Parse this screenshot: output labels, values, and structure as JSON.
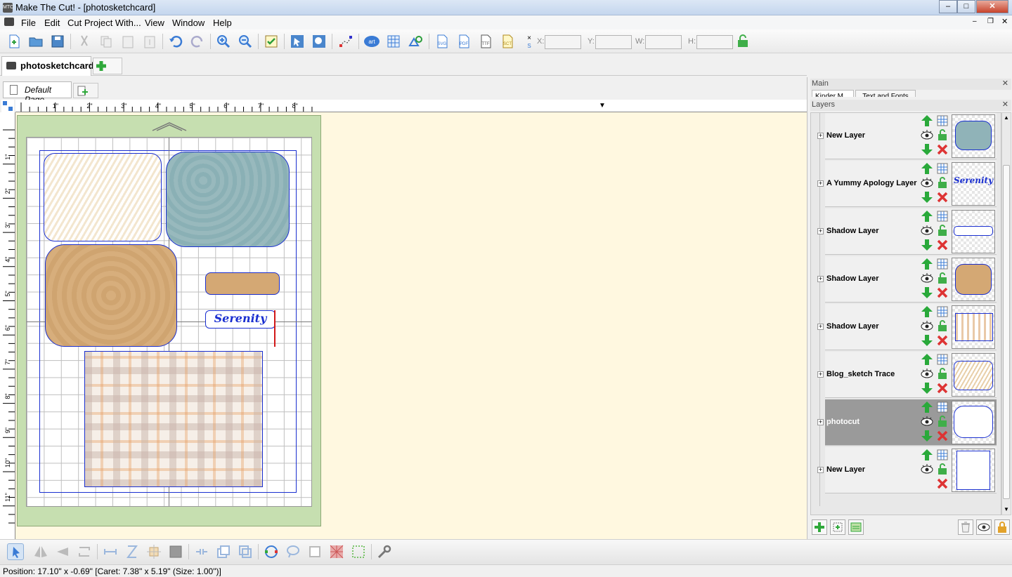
{
  "window": {
    "title": "Make The Cut! - [photosketchcard]"
  },
  "menu": [
    "File",
    "Edit",
    "Cut Project With...",
    "View",
    "Window",
    "Help"
  ],
  "coords": {
    "x_label": "X:",
    "y_label": "Y:",
    "w_label": "W:",
    "h_label": "H:"
  },
  "doc_tab": {
    "label": "photosketchcard"
  },
  "page_tab": {
    "label": "Default Page"
  },
  "ruler": {
    "h_ticks": [
      "1\"",
      "2\"",
      "3\"",
      "4\"",
      "5\"",
      "6\"",
      "7\"",
      "8\""
    ],
    "v_ticks": [
      "1\"",
      "2\"",
      "3\"",
      "4\"",
      "5\"",
      "6\"",
      "7\"",
      "8\"",
      "9\"",
      "10\"",
      "11\""
    ]
  },
  "canvas": {
    "serenity_text": "Serenity"
  },
  "panels": {
    "main_title": "Main",
    "main_tabs": [
      "Kinder M...",
      "Text and Fonts"
    ],
    "layers_title": "Layers"
  },
  "layers": [
    {
      "name": "New Layer",
      "thumb": "teal-rounded",
      "selected": false
    },
    {
      "name": "A Yummy Apology Layer",
      "thumb": "serenity-text",
      "selected": false
    },
    {
      "name": "Shadow Layer",
      "thumb": "pill-outline",
      "selected": false
    },
    {
      "name": "Shadow Layer",
      "thumb": "tan-rounded",
      "selected": false
    },
    {
      "name": "Shadow Layer",
      "thumb": "plaid",
      "selected": false
    },
    {
      "name": "Blog_sketch Trace",
      "thumb": "sketch",
      "selected": false
    },
    {
      "name": "photocut",
      "thumb": "rounded-outline",
      "selected": true
    },
    {
      "name": "New Layer",
      "thumb": "rect-outline",
      "selected": false
    }
  ],
  "status": {
    "text": "Position: 17.10\" x -0.69\" [Caret: 7.38\" x 5.19\" (Size: 1.00\")]"
  },
  "colors": {
    "mat_green": "#c6dfb0",
    "canvas_bg": "#fff8e0",
    "selected_layer": "#9a9a9a",
    "shape_stroke": "#1a2fd0"
  }
}
